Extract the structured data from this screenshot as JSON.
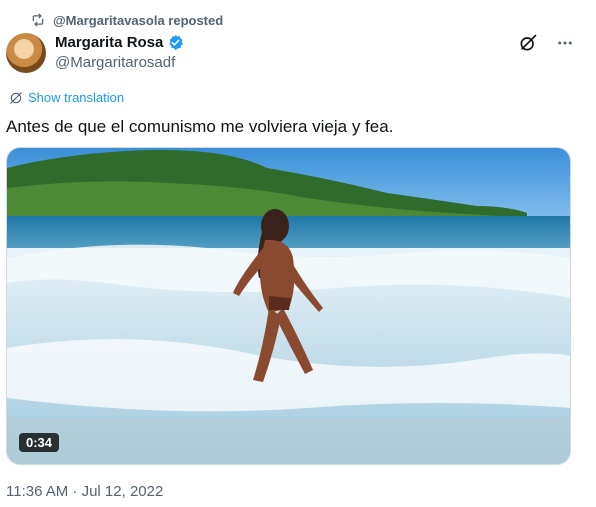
{
  "repost": {
    "text": "@Margaritavasola reposted",
    "icon": "repost-icon"
  },
  "author": {
    "name": "Margarita Rosa",
    "handle": "@Margaritarosadf",
    "verified_color": "#1d9bf0"
  },
  "actions": {
    "grok_icon": "slash-circle-icon",
    "more_icon": "more-dots-icon"
  },
  "translate": {
    "label": "Show translation",
    "color": "#1d9bf0"
  },
  "tweet": {
    "text": "Antes de que el comunismo me volviera vieja y fea."
  },
  "media": {
    "duration": "0:34",
    "type": "video"
  },
  "timestamp": "11:36 AM · Jul 12, 2022",
  "colors": {
    "secondary_text": "#536471",
    "primary_text": "#0f1419"
  }
}
